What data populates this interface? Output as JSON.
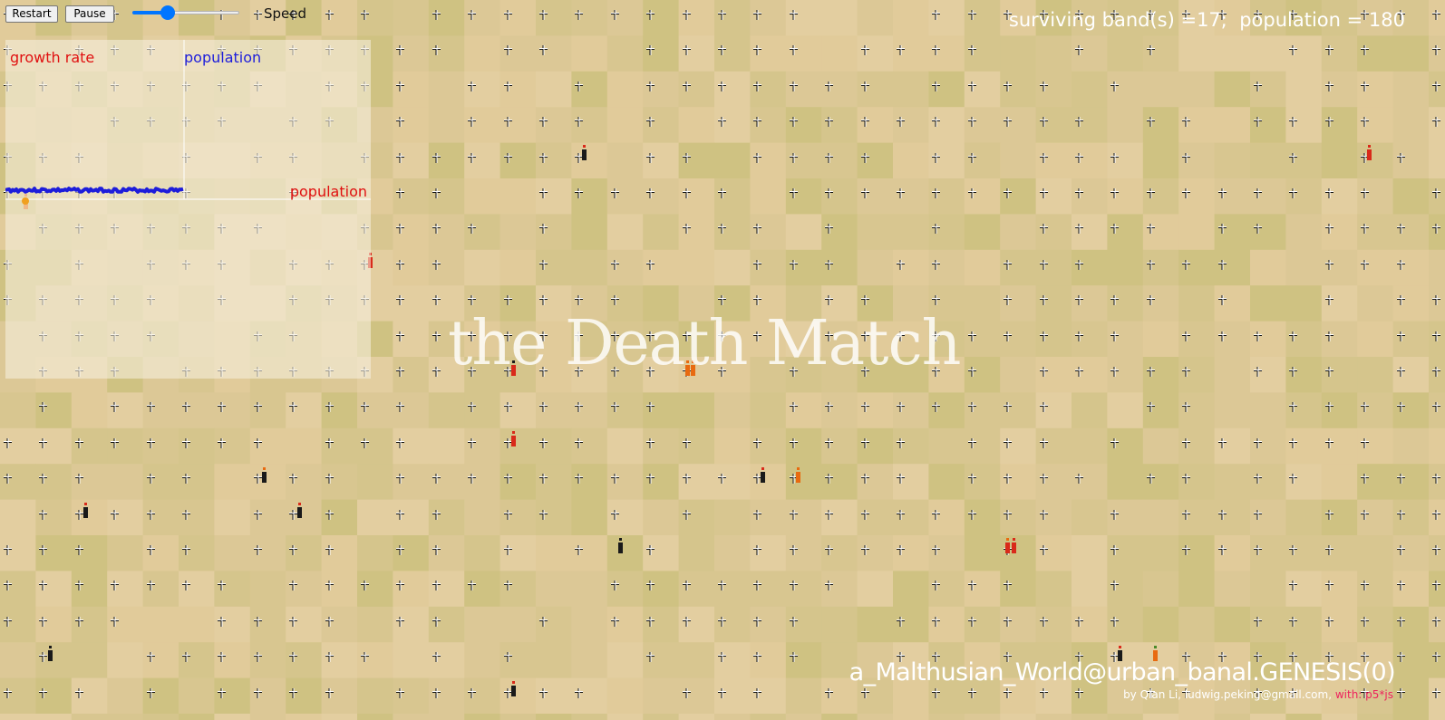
{
  "controls": {
    "restart_label": "Restart",
    "pause_label": "Pause",
    "speed_label": "Speed",
    "speed_value": 0.33
  },
  "stats": {
    "text": "surviving band(s) =17;  population = 180",
    "surviving_bands": 17,
    "population": 180
  },
  "graph": {
    "growth_rate_label": "growth rate",
    "population_label": "population",
    "population_axis_label": "population",
    "growth_color": "#e01010",
    "population_color": "#1d1ddb"
  },
  "title": "the Death Match",
  "footer": {
    "title": "a_Malthusian_World@urban_banal.GENESIS(0)",
    "credit_text": "by Qian Li, ludwig.peking@gmail.com,  ",
    "credit_p5": "with: p5*js"
  },
  "colors": {
    "terrain_base": "#dcc896",
    "terrain_variants": [
      "#dcc896",
      "#d5c58c",
      "#e1cb9a",
      "#cfc282",
      "#d8c690",
      "#e3ceA0"
    ],
    "person_red": "#d92a1a",
    "person_black": "#1a1a1a",
    "person_orange": "#e86a10",
    "person_green": "#4a8a2a"
  },
  "icons": {
    "grave_marker": "cross-icon",
    "band_member": "person-icon"
  }
}
